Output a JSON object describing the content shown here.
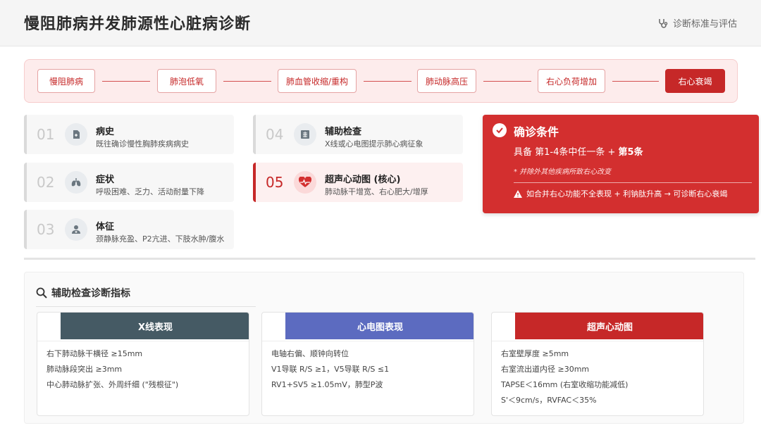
{
  "header": {
    "title": "慢阻肺病并发肺源性心脏病诊断",
    "right_label": "诊断标准与评估",
    "right_icon": "stethoscope-icon"
  },
  "flow": {
    "steps": [
      "慢阻肺病",
      "肺泡低氧",
      "肺血管收缩/重构",
      "肺动脉高压",
      "右心负荷增加",
      "右心衰竭"
    ]
  },
  "criteria": [
    {
      "num": "01",
      "title": "病史",
      "desc": "既往确诊慢性胸肺疾病病史",
      "icon": "document-icon"
    },
    {
      "num": "02",
      "title": "症状",
      "desc": "呼吸困难、乏力、活动耐量下降",
      "icon": "lungs-icon"
    },
    {
      "num": "03",
      "title": "体征",
      "desc": "颈静脉充盈、P2亢进、下肢水肿/腹水",
      "icon": "doctor-icon"
    },
    {
      "num": "04",
      "title": "辅助检查",
      "desc": "X线或心电图提示肺心病征象",
      "icon": "xray-icon"
    },
    {
      "num": "05",
      "title": "超声心动图 (核心)",
      "desc": "肺动脉干增宽、右心肥大/增厚",
      "icon": "heartbeat-icon"
    }
  ],
  "diagnosis": {
    "title": "确诊条件",
    "cond_prefix": "具备 第1-4条中任一条 + ",
    "cond_bold": "第5条",
    "note": "* 并除外其他疾病所致右心改变",
    "warning": "如合并右心功能不全表现 + 利钠肽升高 → 可诊断右心衰竭"
  },
  "indicators": {
    "title": "辅助检查诊断指标",
    "cards": [
      {
        "title": "X线表现",
        "color": "#455a64",
        "items": [
          "右下肺动脉干横径 ≥15mm",
          "肺动脉段突出 ≥3mm",
          "中心肺动脉扩张、外周纤细 (\"残根征\")"
        ]
      },
      {
        "title": "心电图表现",
        "color": "#5c6bc0",
        "items": [
          "电轴右偏、顺钟向转位",
          "V1导联 R/S ≥1，V5导联 R/S ≤1",
          "RV1+SV5 ≥1.05mV，肺型P波"
        ]
      },
      {
        "title": "超声心动图",
        "color": "#c62828",
        "items": [
          "右室壁厚度 ≥5mm",
          "右室流出道内径 ≥30mm",
          "TAPSE＜16mm (右室收缩功能减低)",
          "S'＜9cm/s，RVFAC＜35%"
        ]
      }
    ]
  },
  "colors": {
    "accent": "#c62828",
    "diag_bg": "#d32f2f",
    "flow_bg": "#fdecec"
  }
}
